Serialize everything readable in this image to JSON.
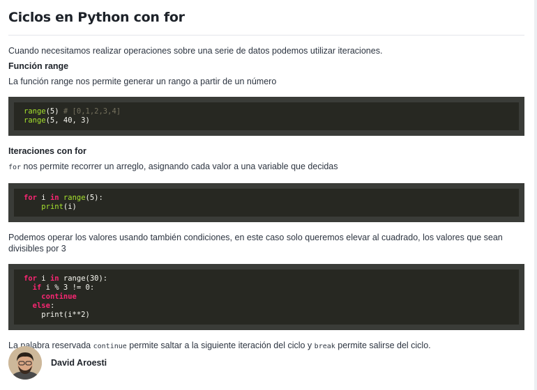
{
  "title": "Ciclos en Python con for",
  "intro": "Cuando necesitamos realizar operaciones sobre una serie de datos podemos utilizar iteraciones.",
  "section_range": {
    "heading": "Función range",
    "text": "La función range nos permite generar un rango a partir de un número"
  },
  "code_range": [
    [
      {
        "t": "range",
        "c": "fn"
      },
      {
        "t": "(5) "
      },
      {
        "t": "# [0,1,2,3,4]",
        "c": "cm"
      }
    ],
    [
      {
        "t": "range",
        "c": "fn"
      },
      {
        "t": "(5, 40, 3)"
      }
    ]
  ],
  "section_for": {
    "heading": "Iteraciones con for",
    "code_word": "for",
    "text": " nos permite recorrer un arreglo, asignando cada valor a una variable que decidas"
  },
  "code_for": [
    [
      {
        "t": "for",
        "c": "kw"
      },
      {
        "t": " i "
      },
      {
        "t": "in",
        "c": "kw"
      },
      {
        "t": " "
      },
      {
        "t": "range",
        "c": "fn"
      },
      {
        "t": "(5):"
      }
    ],
    [
      {
        "t": "    "
      },
      {
        "t": "print",
        "c": "fn"
      },
      {
        "t": "(i)"
      }
    ]
  ],
  "conditions_text": "Podemos operar los valores usando también condiciones, en este caso solo queremos elevar al cuadrado, los valores que sean divisibles por 3",
  "code_conditions": [
    [
      {
        "t": "for",
        "c": "kw"
      },
      {
        "t": " i "
      },
      {
        "t": "in",
        "c": "kw"
      },
      {
        "t": " range(30):"
      }
    ],
    [
      {
        "t": "  "
      },
      {
        "t": "if",
        "c": "kw"
      },
      {
        "t": " i % 3 != 0:"
      }
    ],
    [
      {
        "t": "    "
      },
      {
        "t": "continue",
        "c": "kw"
      }
    ],
    [
      {
        "t": "  "
      },
      {
        "t": "else",
        "c": "kw"
      },
      {
        "t": ":"
      }
    ],
    [
      {
        "t": "    print(i**2)"
      }
    ]
  ],
  "closing": {
    "before": "La palabra reservada ",
    "word1": "continue",
    "middle": " permite saltar a la siguiente iteración del ciclo y ",
    "word2": "break",
    "after": " permite salirse del ciclo."
  },
  "author": {
    "name": "David Aroesti"
  }
}
